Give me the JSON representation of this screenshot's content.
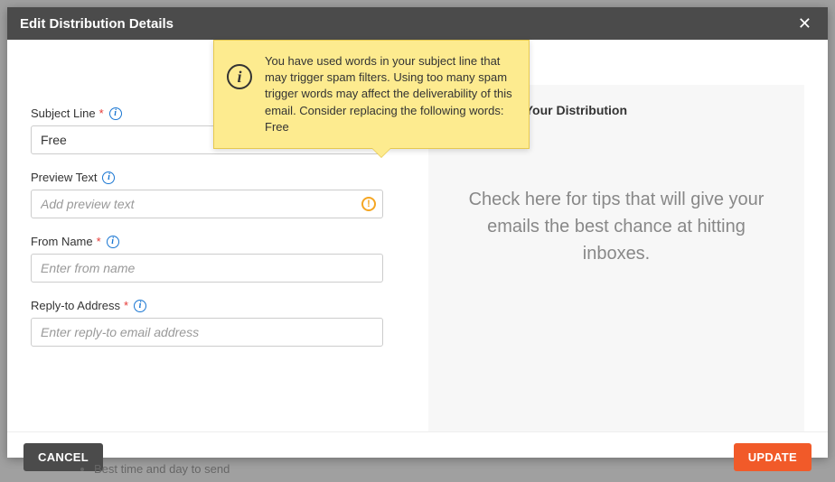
{
  "modal": {
    "title": "Edit Distribution Details",
    "tooltip": "You have used words in your subject line that may trigger spam filters. Using too many spam trigger words may affect the deliverability of this email. Consider replacing the following words: Free"
  },
  "fields": {
    "subject": {
      "label": "Subject Line",
      "value": "Free"
    },
    "preview": {
      "label": "Preview Text",
      "placeholder": "Add preview text"
    },
    "fromName": {
      "label": "From Name",
      "placeholder": "Enter from name"
    },
    "replyTo": {
      "label": "Reply-to Address",
      "placeholder": "Enter reply-to email address"
    }
  },
  "rightPanel": {
    "title": "Optimize Your Distribution",
    "body": "Check here for tips that will give your emails the best chance at hitting inboxes."
  },
  "footer": {
    "cancel": "CANCEL",
    "update": "UPDATE"
  },
  "bgText": "Best time and day to send"
}
